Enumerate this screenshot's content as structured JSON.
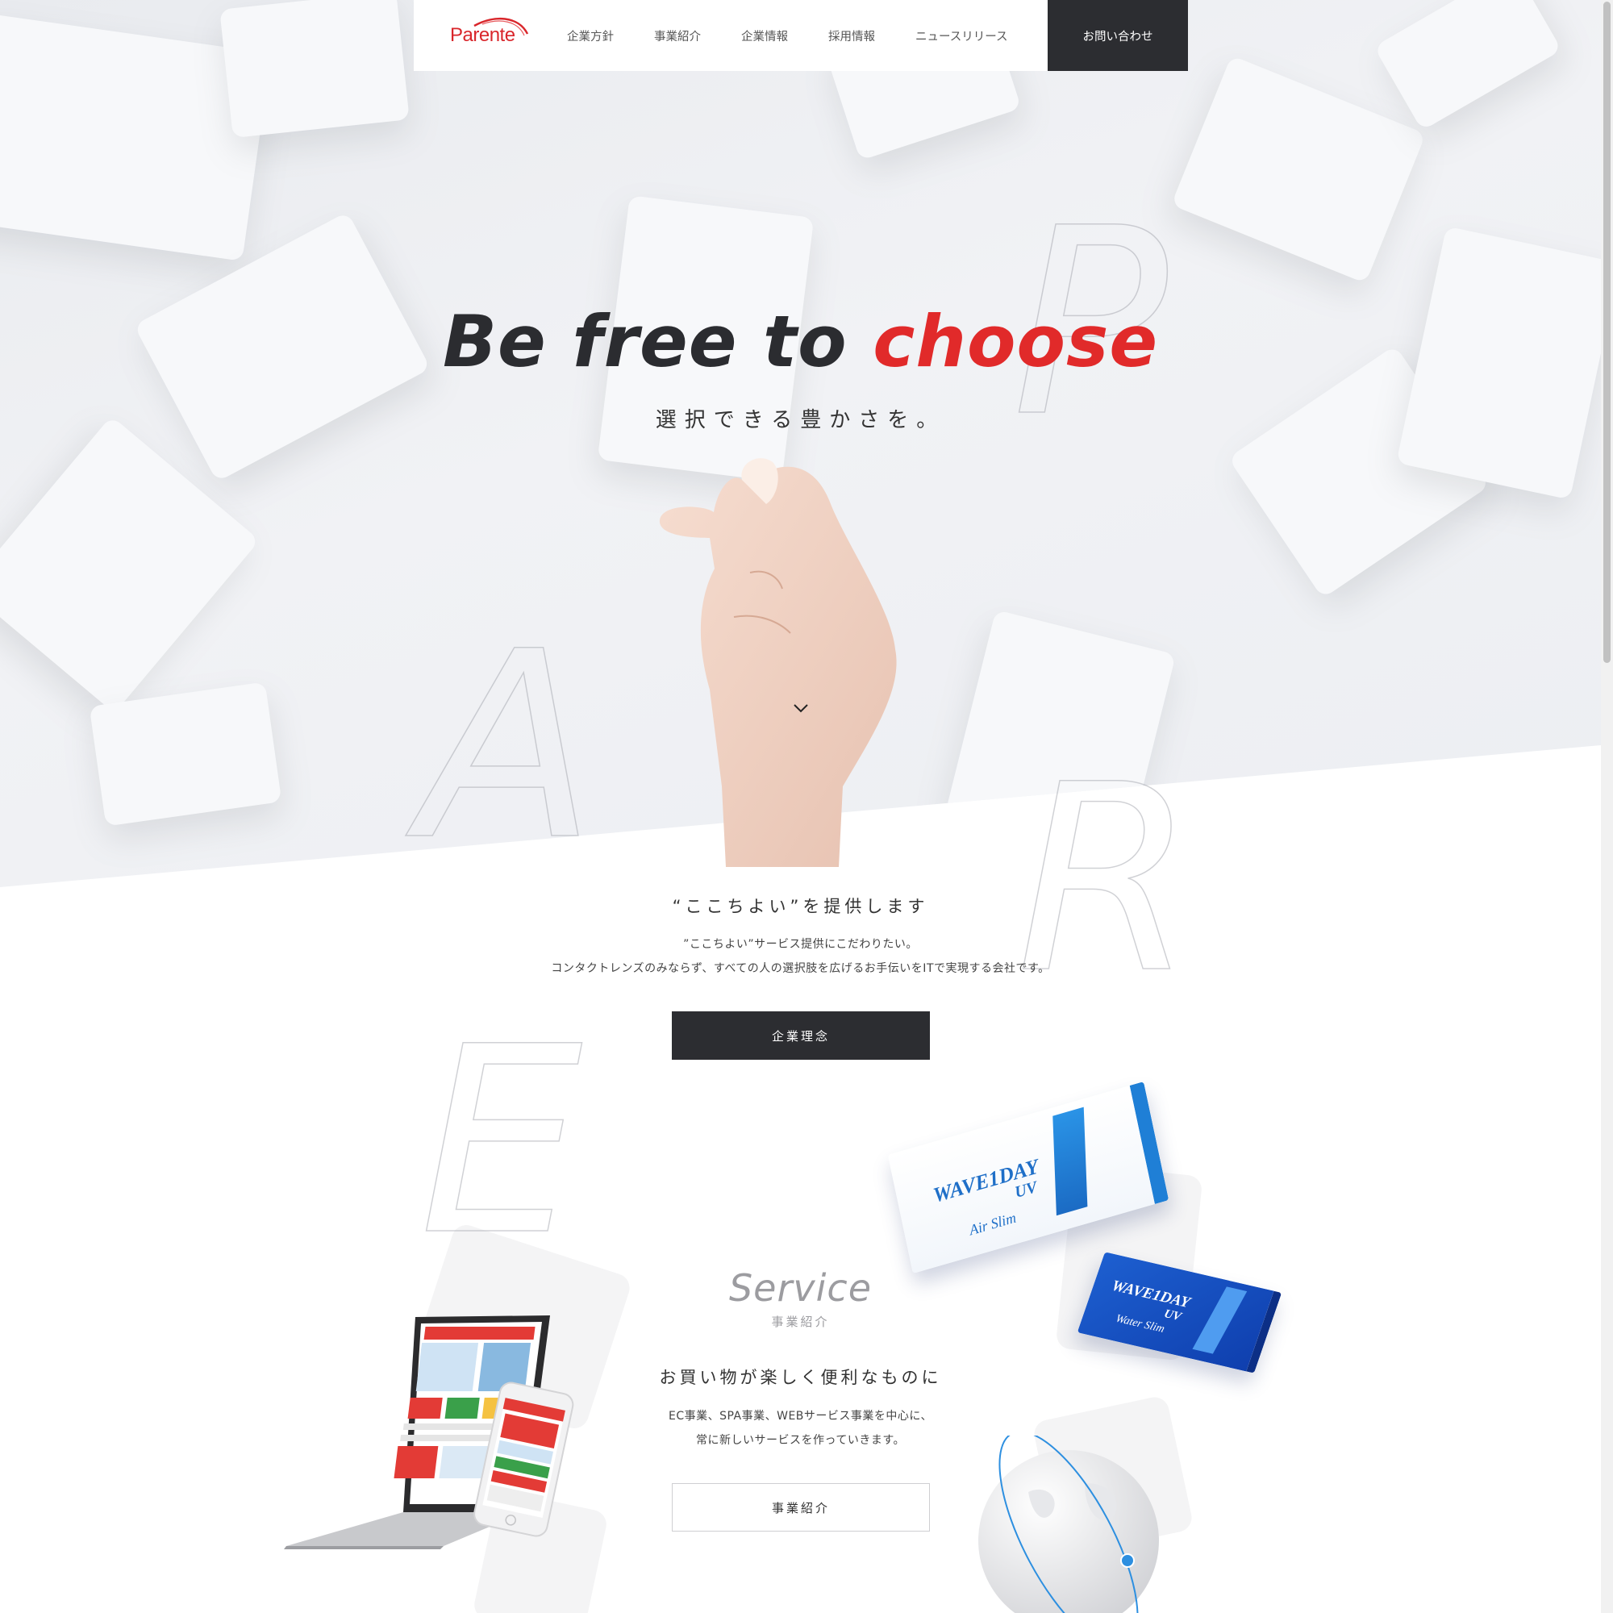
{
  "nav": {
    "logo_text": "Parente",
    "links": [
      "企業方針",
      "事業紹介",
      "企業情報",
      "採用情報",
      "ニュースリリース"
    ],
    "contact_label": "お問い合わせ"
  },
  "hero": {
    "title_main": "Be free to ",
    "title_accent": "choose",
    "subtitle": "選択できる豊かさを。",
    "accent_color": "#e12a2a",
    "letters": [
      "P",
      "A",
      "R",
      "E"
    ]
  },
  "intro": {
    "heading": "“ここちよい”を提供します",
    "line1": "”ここちよい”サービス提供にこだわりたい。",
    "line2": "コンタクトレンズのみならず、すべての人の選択肢を広げるお手伝いをITで実現する会社です。",
    "button_label": "企業理念"
  },
  "service": {
    "title": "Service",
    "subtitle": "事業紹介",
    "heading": "お買い物が楽しく便利なものに",
    "line1": "EC事業、SPA事業、WEBサービス事業を中心に、",
    "line2": "常に新しいサービスを作っていきます。",
    "button_label": "事業紹介"
  },
  "products": {
    "box1_brand": "WAVE1DAY",
    "box1_uv": "UV",
    "box1_name": "Air Slim",
    "box2_brand": "WAVE1DAY",
    "box2_uv": "UV",
    "box2_name": "Water Slim"
  }
}
